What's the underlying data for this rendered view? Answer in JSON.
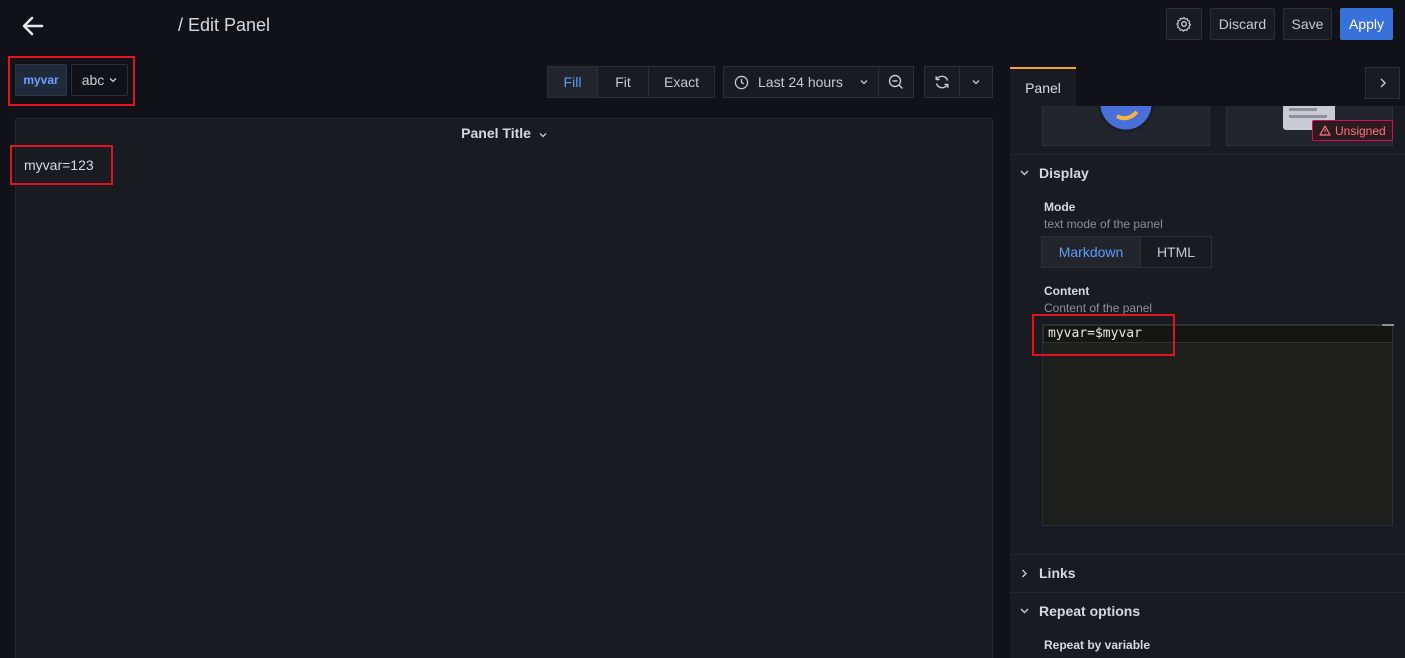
{
  "header": {
    "title": "/ Edit Panel",
    "discard_label": "Discard",
    "save_label": "Save",
    "apply_label": "Apply"
  },
  "variables": {
    "name": "myvar",
    "value": "abc"
  },
  "view_modes": {
    "items": [
      "Fill",
      "Fit",
      "Exact"
    ],
    "active": "Fill"
  },
  "time_range": {
    "label": "Last 24 hours"
  },
  "panel": {
    "title": "Panel Title",
    "content": "myvar=123"
  },
  "sidebar": {
    "tab_label": "Panel",
    "unsigned_badge": "Unsigned",
    "display": {
      "heading": "Display",
      "mode_label": "Mode",
      "mode_desc": "text mode of the panel",
      "modes": [
        "Markdown",
        "HTML"
      ],
      "active_mode": "Markdown",
      "content_label": "Content",
      "content_desc": "Content of the panel",
      "content_value": "myvar=$myvar"
    },
    "links_heading": "Links",
    "repeat": {
      "heading": "Repeat options",
      "field_label": "Repeat by variable"
    }
  },
  "colors": {
    "accent": "#3871dc",
    "active_text": "#5b9cff",
    "tab_highlight": "#f5a623",
    "annotation_red": "#e0141e",
    "badge_red": "#ff7383"
  }
}
